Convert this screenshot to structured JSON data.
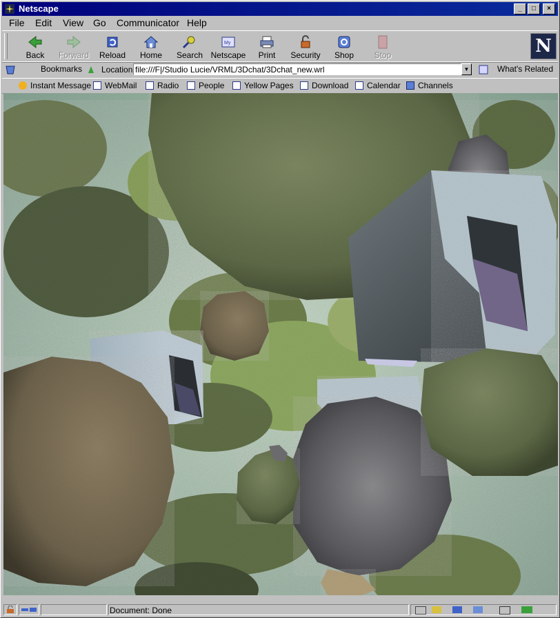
{
  "window": {
    "title": "Netscape"
  },
  "menu": {
    "file": "File",
    "edit": "Edit",
    "view": "View",
    "go": "Go",
    "communicator": "Communicator",
    "help": "Help"
  },
  "toolbar": {
    "back": "Back",
    "forward": "Forward",
    "reload": "Reload",
    "home": "Home",
    "search": "Search",
    "netscape": "Netscape",
    "print": "Print",
    "security": "Security",
    "shop": "Shop",
    "stop": "Stop",
    "logo_letter": "N"
  },
  "location": {
    "bookmarks": "Bookmarks",
    "label": "Location:",
    "url": "file:///F|/Studio Lucie/VRML/3Dchat/3Dchat_new.wrl",
    "related": "What's Related"
  },
  "personal": {
    "instant_message": "Instant Message",
    "webmail": "WebMail",
    "radio": "Radio",
    "people": "People",
    "yellow_pages": "Yellow Pages",
    "download": "Download",
    "calendar": "Calendar",
    "channels": "Channels"
  },
  "status": {
    "text": "Document: Done"
  },
  "icons": {
    "back": "back-arrow-icon",
    "forward": "forward-arrow-icon",
    "reload": "reload-icon",
    "home": "home-icon",
    "search": "search-icon",
    "netscape": "my-netscape-icon",
    "print": "printer-icon",
    "security": "lock-icon",
    "shop": "shop-icon",
    "stop": "stop-icon"
  }
}
